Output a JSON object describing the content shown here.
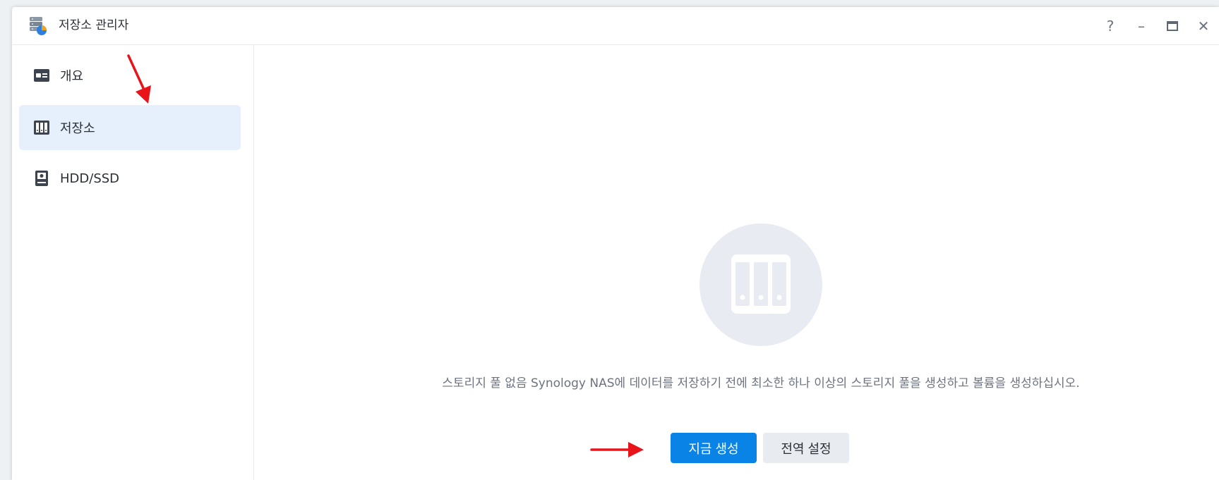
{
  "window": {
    "title": "저장소 관리자",
    "controls": [
      "?",
      "–",
      "□",
      "✕"
    ]
  },
  "sidebar": {
    "items": [
      {
        "label": "개요",
        "icon": "overview-icon",
        "active": false
      },
      {
        "label": "저장소",
        "icon": "storage-icon",
        "active": true
      },
      {
        "label": "HDD/SSD",
        "icon": "hdd-icon",
        "active": false
      }
    ]
  },
  "main": {
    "empty_message": "스토리지 풀 없음 Synology NAS에 데이터를 저장하기 전에 최소한 하나 이상의 스토리지 풀을 생성하고 볼륨을 생성하십시오.",
    "primary_button": "지금 생성",
    "secondary_button": "전역 설정"
  },
  "colors": {
    "accent": "#0a83e6",
    "active_nav_bg": "#e5f0fc",
    "annotation": "#e8141a"
  }
}
